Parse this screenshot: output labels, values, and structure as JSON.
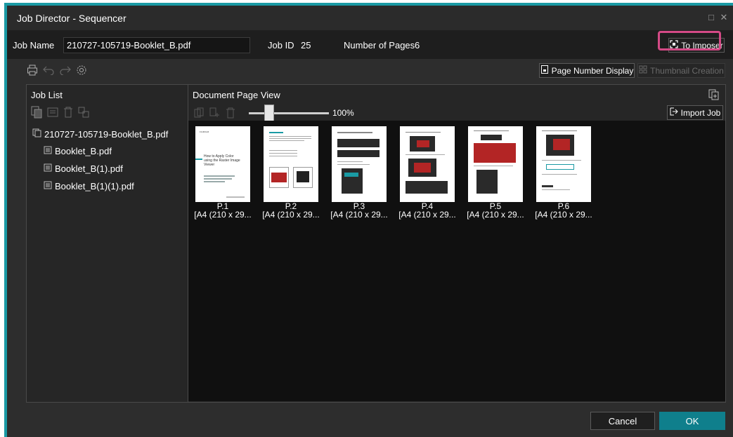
{
  "window": {
    "title": "Job Director - Sequencer",
    "restore_glyph": "□",
    "close_glyph": "✕"
  },
  "jobbar": {
    "job_name_label": "Job Name",
    "job_name_value": "210727-105719-Booklet_B.pdf",
    "job_id_label": "Job ID",
    "job_id_value": "25",
    "pages_label": "Number of Pages",
    "pages_value": "6",
    "to_imposer_label": "To Imposer"
  },
  "toolbar": {
    "page_number_display_label": "Page Number Display",
    "thumbnail_creation_label": "Thumbnail Creation"
  },
  "job_list": {
    "title": "Job List",
    "items": [
      {
        "label": "210727-105719-Booklet_B.pdf"
      },
      {
        "label": "Booklet_B.pdf"
      },
      {
        "label": "Booklet_B(1).pdf"
      },
      {
        "label": "Booklet_B(1)(1).pdf"
      }
    ]
  },
  "page_view": {
    "title": "Document Page View",
    "zoom": "100%",
    "import_job_label": "Import Job",
    "pages": [
      {
        "page": "P.1",
        "size": "[A4 (210 x 29..."
      },
      {
        "page": "P.2",
        "size": "[A4 (210 x 29..."
      },
      {
        "page": "P.3",
        "size": "[A4 (210 x 29..."
      },
      {
        "page": "P.4",
        "size": "[A4 (210 x 29..."
      },
      {
        "page": "P.5",
        "size": "[A4 (210 x 29..."
      },
      {
        "page": "P.6",
        "size": "[A4 (210 x 29..."
      }
    ]
  },
  "thumb1_text": {
    "brand": "FUJIFILM",
    "heading": "How to Apply Color using the Raster Image Viewer"
  },
  "footer": {
    "cancel_label": "Cancel",
    "ok_label": "OK"
  },
  "colors": {
    "accent": "#1a9aa4",
    "highlight": "#d44a86",
    "ok_button": "#0f7f8c"
  }
}
